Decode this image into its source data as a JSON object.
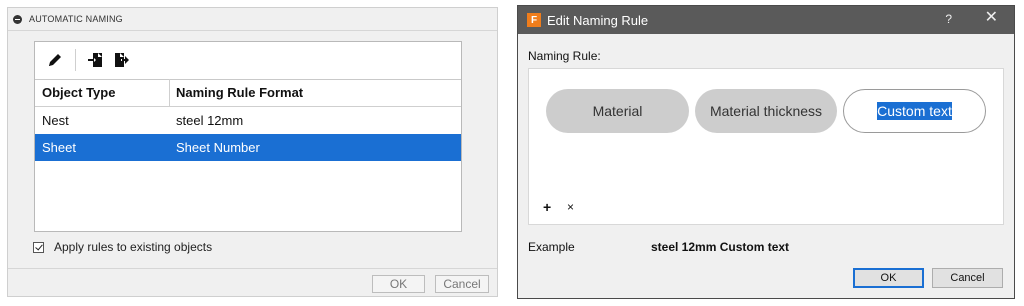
{
  "automatic_naming": {
    "title": "AUTOMATIC NAMING",
    "toolbar": {
      "icons": [
        "pencil-icon",
        "import-icon",
        "export-icon"
      ]
    },
    "table": {
      "headers": [
        "Object Type",
        "Naming Rule Format"
      ],
      "rows": [
        {
          "object_type": "Nest",
          "format": "steel 12mm",
          "selected": false
        },
        {
          "object_type": "Sheet",
          "format": "Sheet Number",
          "selected": true
        }
      ]
    },
    "apply_checkbox": {
      "label": "Apply rules to existing objects",
      "checked": true
    },
    "ok_label": "OK",
    "cancel_label": "Cancel"
  },
  "edit_dialog": {
    "title": "Edit Naming Rule",
    "app_icon_letter": "F",
    "help_label": "?",
    "close_label": "✕",
    "naming_rule_label": "Naming Rule:",
    "tokens": [
      "Material",
      "Material thickness",
      "Custom text"
    ],
    "add_label": "+",
    "remove_label": "×",
    "example_label": "Example",
    "example_value": "steel 12mm Custom text",
    "ok_label": "OK",
    "cancel_label": "Cancel"
  },
  "colors": {
    "selection_blue": "#1a6fd3",
    "titlebar_grey": "#5a5a5a",
    "app_icon_orange": "#f07d1b"
  }
}
